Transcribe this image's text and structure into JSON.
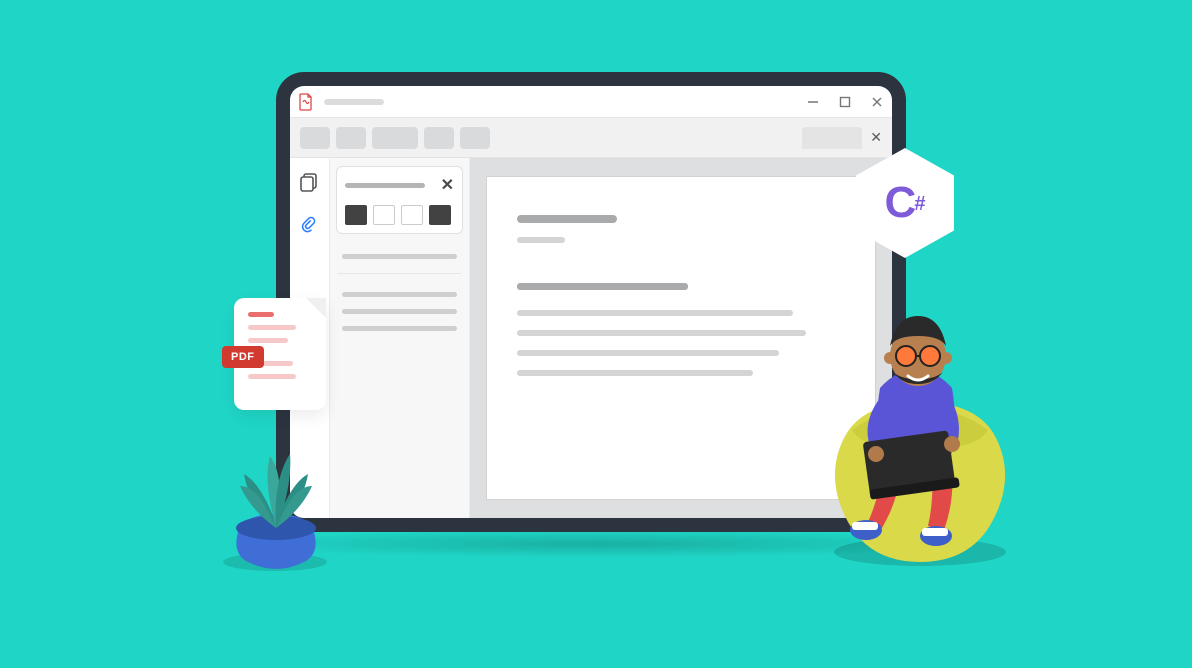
{
  "pdf_badge": {
    "label": "PDF"
  },
  "csharp_badge": {
    "letter": "C",
    "hash": "#"
  },
  "colors": {
    "background": "#1fd6c6",
    "pdf_red": "#d13a2f",
    "csharp_purple": "#7e5cd9"
  },
  "window": {
    "controls": [
      "minimize",
      "maximize",
      "close"
    ]
  },
  "sidebar_rail": {
    "icons": [
      "pages-icon",
      "attachment-icon"
    ]
  }
}
